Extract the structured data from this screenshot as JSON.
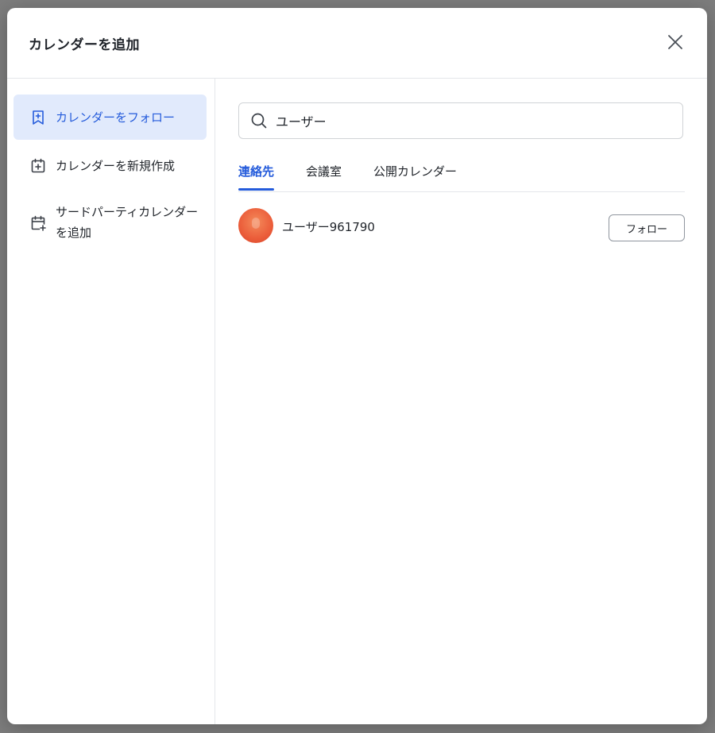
{
  "dialog": {
    "title": "カレンダーを追加",
    "close_icon": "close-icon"
  },
  "sidebar": {
    "items": [
      {
        "label": "カレンダーをフォロー",
        "icon": "bookmark-plus-icon",
        "active": true
      },
      {
        "label": "カレンダーを新規作成",
        "icon": "calendar-plus-icon",
        "active": false
      },
      {
        "label": "サードパーティカレンダーを追加",
        "icon": "calendar-add-icon",
        "active": false
      }
    ]
  },
  "search": {
    "value": "ユーザー",
    "icon": "search-icon"
  },
  "tabs": [
    {
      "label": "連絡先",
      "active": true
    },
    {
      "label": "会議室",
      "active": false
    },
    {
      "label": "公開カレンダー",
      "active": false
    }
  ],
  "results": [
    {
      "name": "ユーザー961790",
      "action_label": "フォロー"
    }
  ],
  "colors": {
    "accent": "#245bdb",
    "active_bg": "#e1eafc",
    "avatar": "#eb5d3a"
  }
}
